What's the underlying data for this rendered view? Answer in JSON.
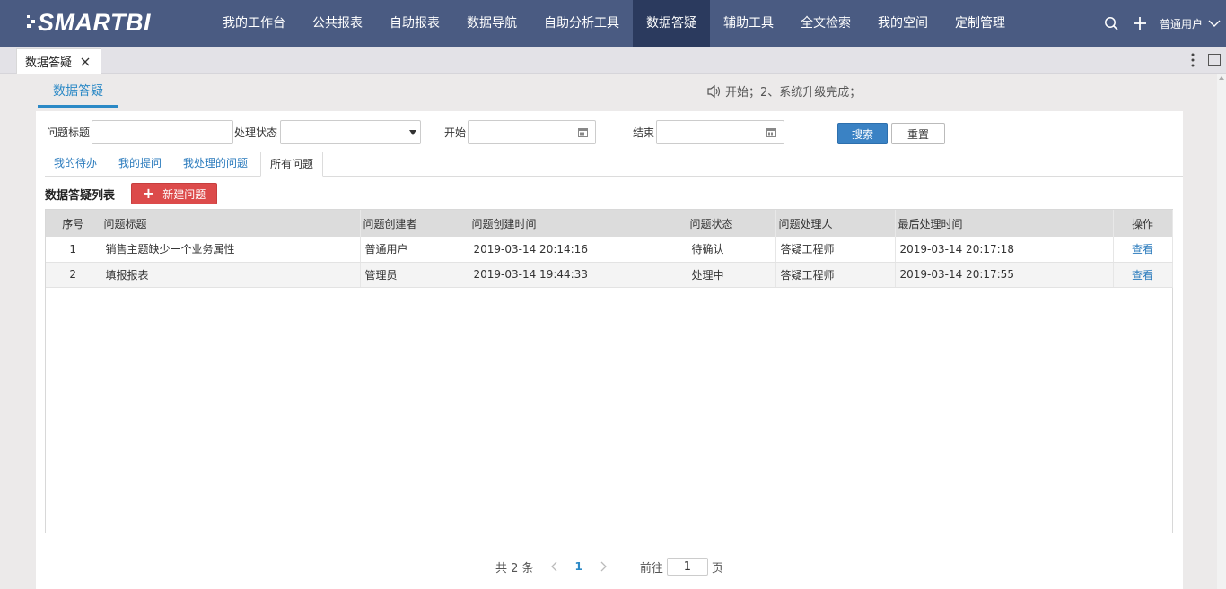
{
  "app": {
    "logo_text": "SMARTBI",
    "colors": {
      "nav_bg": "#4a5b82",
      "nav_active": "#2b3a5e",
      "accent": "#2b89c6",
      "primary_button": "#3a82c4",
      "new_button": "#dc4b4b"
    }
  },
  "nav": {
    "items": [
      {
        "label": "我的工作台"
      },
      {
        "label": "公共报表"
      },
      {
        "label": "自助报表"
      },
      {
        "label": "数据导航"
      },
      {
        "label": "自助分析工具"
      },
      {
        "label": "数据答疑",
        "active": true
      },
      {
        "label": "辅助工具"
      },
      {
        "label": "全文检索"
      },
      {
        "label": "我的空间"
      },
      {
        "label": "定制管理"
      }
    ],
    "user": "普通用户",
    "icons": [
      "search-icon",
      "plus-icon",
      "chevron-down-icon"
    ]
  },
  "tabbar": {
    "tab_label": "数据答疑",
    "icons": [
      "close-icon",
      "more-vertical-icon",
      "maximize-icon"
    ]
  },
  "section": {
    "title": "数据答疑",
    "notice": "开始；2、系统升级完成；"
  },
  "filter": {
    "title_label": "问题标题",
    "title_value": "",
    "status_label": "处理状态",
    "status_value": "",
    "start_label": "开始",
    "start_value": "",
    "end_label": "结束",
    "end_value": "",
    "search_label": "搜索",
    "reset_label": "重置"
  },
  "tabs": [
    {
      "label": "我的待办"
    },
    {
      "label": "我的提问"
    },
    {
      "label": "我处理的问题"
    },
    {
      "label": "所有问题",
      "active": true
    }
  ],
  "list": {
    "title": "数据答疑列表",
    "new_button": "新建问题",
    "columns": [
      "序号",
      "问题标题",
      "问题创建者",
      "问题创建时间",
      "问题状态",
      "问题处理人",
      "最后处理时间",
      "操作"
    ],
    "rows": [
      {
        "no": "1",
        "title": "销售主题缺少一个业务属性",
        "creator": "普通用户",
        "created": "2019-03-14 20:14:16",
        "status": "待确认",
        "handler": "答疑工程师",
        "last": "2019-03-14 20:17:18",
        "action": "查看"
      },
      {
        "no": "2",
        "title": "填报报表",
        "creator": "管理员",
        "created": "2019-03-14 19:44:33",
        "status": "处理中",
        "handler": "答疑工程师",
        "last": "2019-03-14 20:17:55",
        "action": "查看"
      }
    ]
  },
  "pager": {
    "total": "共 2 条",
    "current": "1",
    "goto_prefix": "前往",
    "goto_value": "1",
    "goto_suffix": "页"
  }
}
